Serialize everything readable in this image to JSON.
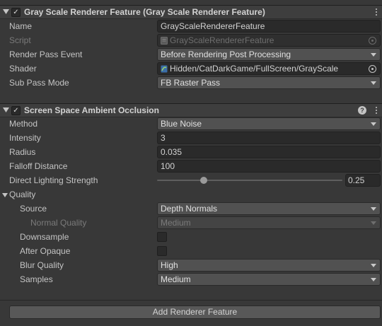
{
  "feature1": {
    "title": "Gray Scale Renderer Feature (Gray Scale Renderer Feature)",
    "enabled_mark": "✓",
    "rows": {
      "name_label": "Name",
      "name_value": "GrayScaleRendererFeature",
      "script_label": "Script",
      "script_value": "GrayScaleRendererFeature",
      "render_pass_event_label": "Render Pass Event",
      "render_pass_event_value": "Before Rendering Post Processing",
      "shader_label": "Shader",
      "shader_value": "Hidden/CatDarkGame/FullScreen/GrayScale",
      "sub_pass_mode_label": "Sub Pass Mode",
      "sub_pass_mode_value": "FB Raster Pass"
    }
  },
  "feature2": {
    "title": "Screen Space Ambient Occlusion",
    "enabled_mark": "✓",
    "help_glyph": "?",
    "rows": {
      "method_label": "Method",
      "method_value": "Blue Noise",
      "intensity_label": "Intensity",
      "intensity_value": "3",
      "radius_label": "Radius",
      "radius_value": "0.035",
      "falloff_label": "Falloff Distance",
      "falloff_value": "100",
      "direct_lighting_label": "Direct Lighting Strength",
      "direct_lighting_value": "0.25",
      "direct_lighting_fraction": 0.25
    },
    "quality": {
      "label": "Quality",
      "source_label": "Source",
      "source_value": "Depth Normals",
      "normal_quality_label": "Normal Quality",
      "normal_quality_value": "Medium",
      "downsample_label": "Downsample",
      "downsample_checked": false,
      "after_opaque_label": "After Opaque",
      "after_opaque_checked": false,
      "blur_quality_label": "Blur Quality",
      "blur_quality_value": "High",
      "samples_label": "Samples",
      "samples_value": "Medium"
    }
  },
  "footer": {
    "add_button_label": "Add Renderer Feature"
  },
  "colors": {
    "background": "#383838",
    "header": "#3e3e3e",
    "field": "#2a2a2a",
    "dropdown": "#515151"
  }
}
